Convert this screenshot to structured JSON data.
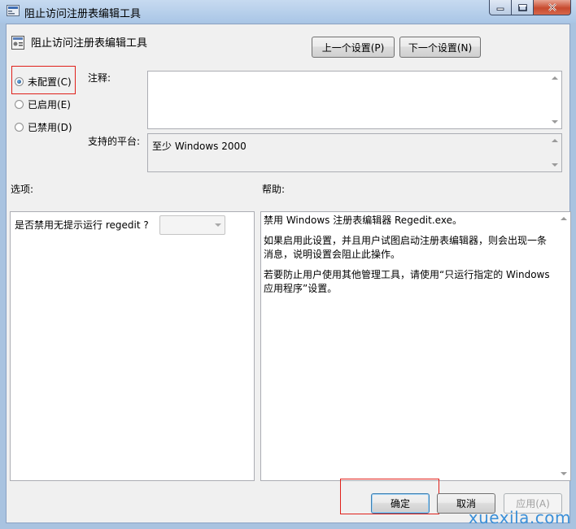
{
  "window": {
    "title": "阻止访问注册表编辑工具",
    "controls": {
      "minimize": "minimize",
      "maximize": "maximize",
      "close": "close"
    }
  },
  "setting": {
    "name": "阻止访问注册表编辑工具",
    "prev_button": "上一个设置(P)",
    "next_button": "下一个设置(N)"
  },
  "state": {
    "options": [
      {
        "label": "未配置(C)",
        "selected": true
      },
      {
        "label": "已启用(E)",
        "selected": false
      },
      {
        "label": "已禁用(D)",
        "selected": false
      }
    ]
  },
  "comment": {
    "label": "注释:",
    "value": ""
  },
  "platform": {
    "label": "支持的平台:",
    "value": "至少 Windows 2000"
  },
  "options_panel": {
    "label": "选项:",
    "question": "是否禁用无提示运行 regedit ?",
    "combo_value": ""
  },
  "help_panel": {
    "label": "帮助:",
    "paragraphs": [
      "禁用 Windows 注册表编辑器 Regedit.exe。",
      "如果启用此设置，并且用户试图启动注册表编辑器，则会出现一条消息，说明设置会阻止此操作。",
      "若要防止用户使用其他管理工具，请使用“只运行指定的 Windows 应用程序”设置。"
    ]
  },
  "footer": {
    "ok": "确定",
    "cancel": "取消",
    "apply": "应用(A)"
  },
  "watermark": "xuexila.com",
  "colors": {
    "highlight_box": "#e0201a",
    "titlebar": "#a9c6e6",
    "dialog_bg": "#f0f0f0"
  }
}
